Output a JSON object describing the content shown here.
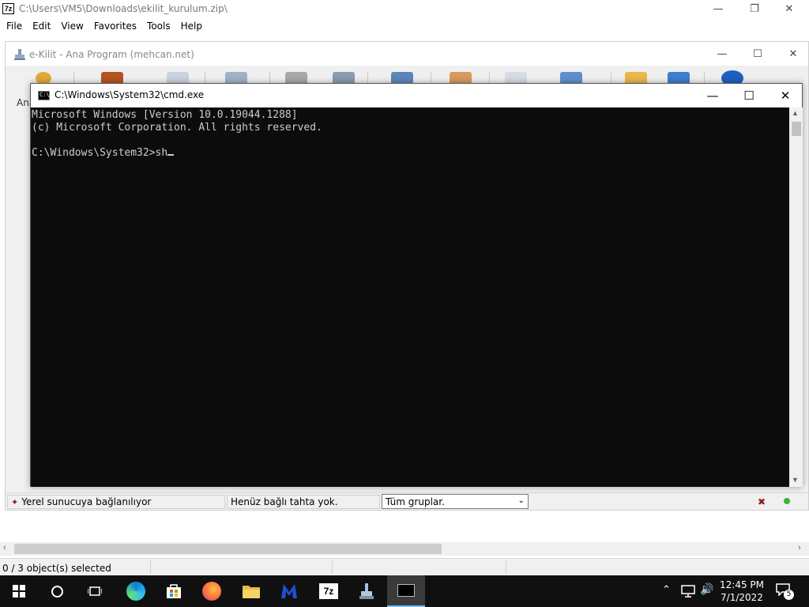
{
  "zip_window": {
    "title": "C:\\Users\\VM5\\Downloads\\ekilit_kurulum.zip\\",
    "logo": "7z",
    "menu": [
      "File",
      "Edit",
      "View",
      "Favorites",
      "Tools",
      "Help"
    ],
    "status": "0 / 3 object(s) selected"
  },
  "ekilit_window": {
    "title": "e-Kilit - Ana Program (mehcan.net)",
    "tab_partial": "Ana",
    "status_connection": "Yerel sunucuya bağlanılıyor",
    "status_board": "Henüz bağlı tahta yok.",
    "group_select": "Tüm gruplar."
  },
  "cmd_window": {
    "title": "C:\\Windows\\System32\\cmd.exe",
    "icon_text": "C:\\",
    "lines": [
      "Microsoft Windows [Version 10.0.19044.1288]",
      "(c) Microsoft Corporation. All rights reserved.",
      "",
      "C:\\Windows\\System32>sh"
    ]
  },
  "taskbar": {
    "apps": [
      "start-icon",
      "search-icon",
      "task-view-icon",
      "edge-icon",
      "store-icon",
      "firefox-icon",
      "file-explorer-icon",
      "malwarebytes-icon",
      "7zip-icon",
      "ekilit-icon",
      "cmd-icon"
    ],
    "zip_label": "7z",
    "time": "12:45 PM",
    "date": "7/1/2022",
    "notification_count": "5"
  },
  "colors": {
    "console_bg": "#0c0c0c",
    "console_fg": "#cccccc",
    "taskbar_bg": "#101010",
    "edge": "#0f7bd4",
    "firefox": "#ff7139",
    "malwarebytes": "#1f4fd8"
  }
}
